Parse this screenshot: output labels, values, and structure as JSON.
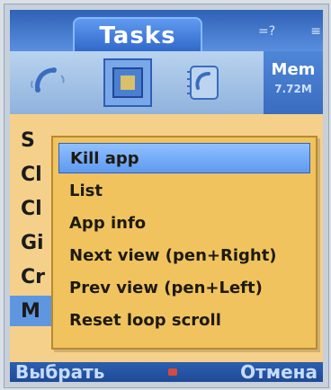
{
  "header": {
    "tab_label": "Tasks",
    "status_text_left": "=?",
    "status_text_right": "≡"
  },
  "iconrow": {
    "icons": [
      "phone-icon",
      "app-icon-selected",
      "phone-book-icon"
    ],
    "mem_label": "Mem",
    "mem_value": "7.72M"
  },
  "list": {
    "items": [
      {
        "label": "S"
      },
      {
        "label": "Cl"
      },
      {
        "label": "Cl"
      },
      {
        "label": "Gi"
      },
      {
        "label": "Cr"
      },
      {
        "label": "M"
      }
    ],
    "selected_index": 5
  },
  "popup": {
    "items": [
      {
        "label": "Kill app",
        "highlight": true
      },
      {
        "label": "List"
      },
      {
        "label": "App info"
      },
      {
        "label": "Next view (pen+Right)"
      },
      {
        "label": "Prev view (pen+Left)"
      },
      {
        "label": "Reset loop scroll"
      }
    ]
  },
  "softkeys": {
    "left": "Выбрать",
    "right": "Отмена"
  },
  "colors": {
    "header_blue": "#2f62b6",
    "popup_bg": "#f0c35e",
    "highlight_blue": "#5f9af0"
  }
}
